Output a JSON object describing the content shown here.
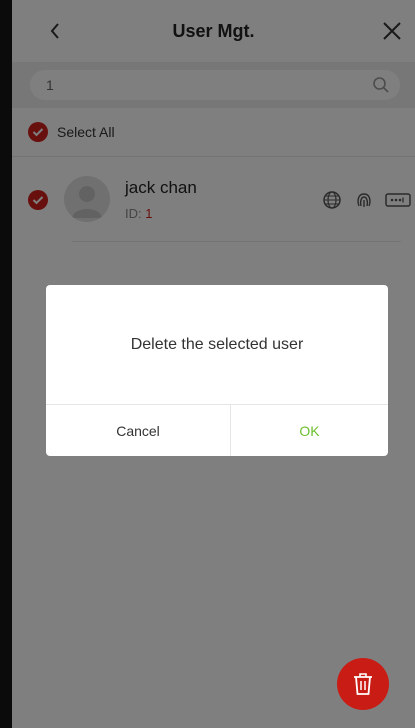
{
  "header": {
    "title": "User Mgt."
  },
  "search": {
    "value": "1"
  },
  "select_all": {
    "label": "Select All",
    "checked": true
  },
  "users": [
    {
      "name": "jack chan",
      "id_label": "ID:",
      "id_value": "1",
      "checked": true,
      "credentials": [
        "face-icon",
        "fingerprint-icon",
        "password-icon"
      ]
    }
  ],
  "dialog": {
    "message": "Delete the selected user",
    "cancel_label": "Cancel",
    "ok_label": "OK"
  },
  "colors": {
    "accent_red": "#d0201b",
    "ok_green": "#6cbf2e",
    "id_red": "#d0201b"
  }
}
